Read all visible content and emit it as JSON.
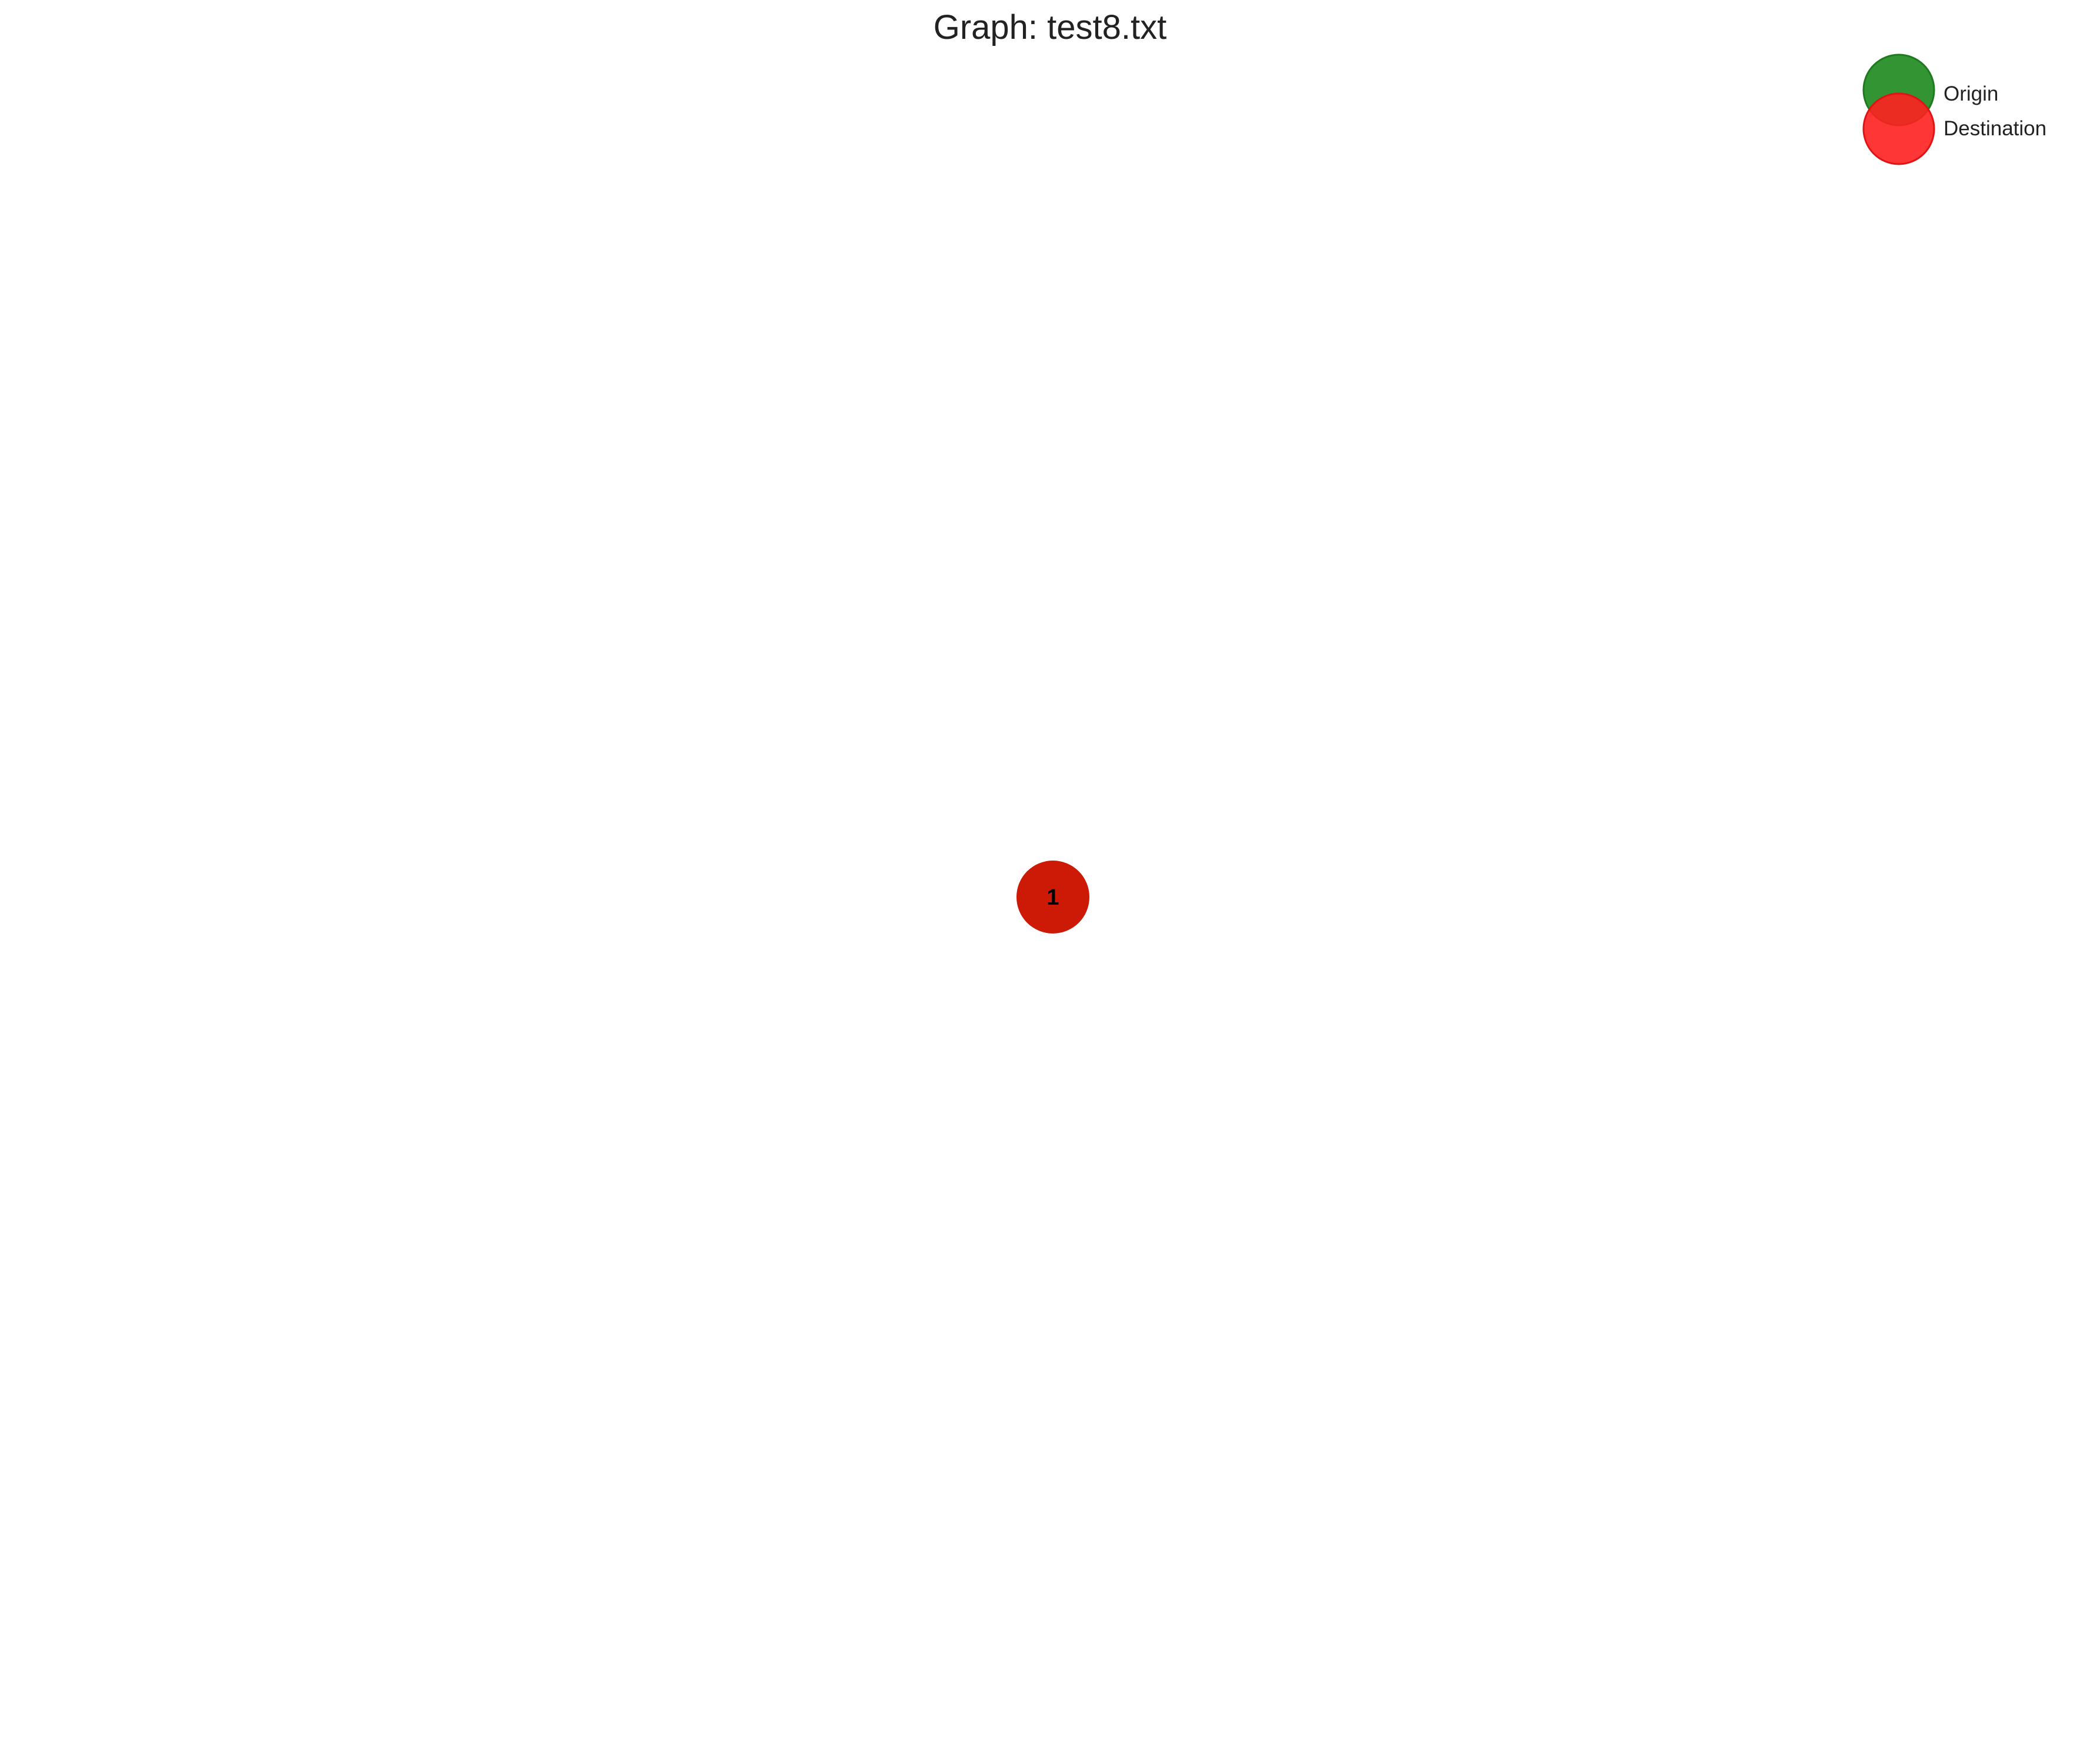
{
  "title": "Graph: test8.txt",
  "legend": {
    "position": "top-right",
    "items": [
      {
        "label": "Origin",
        "color": "#228B22"
      },
      {
        "label": "Destination",
        "color": "#FF2020"
      }
    ]
  },
  "graph": {
    "nodes": [
      {
        "id": "1",
        "label": "1",
        "role": [
          "origin",
          "destination"
        ],
        "fill": "#CC1A06"
      }
    ],
    "edges": []
  },
  "colors": {
    "origin": "#228B22",
    "destination": "#FF2020",
    "node_overlap": "#CC1A06",
    "background": "#FFFFFF"
  }
}
